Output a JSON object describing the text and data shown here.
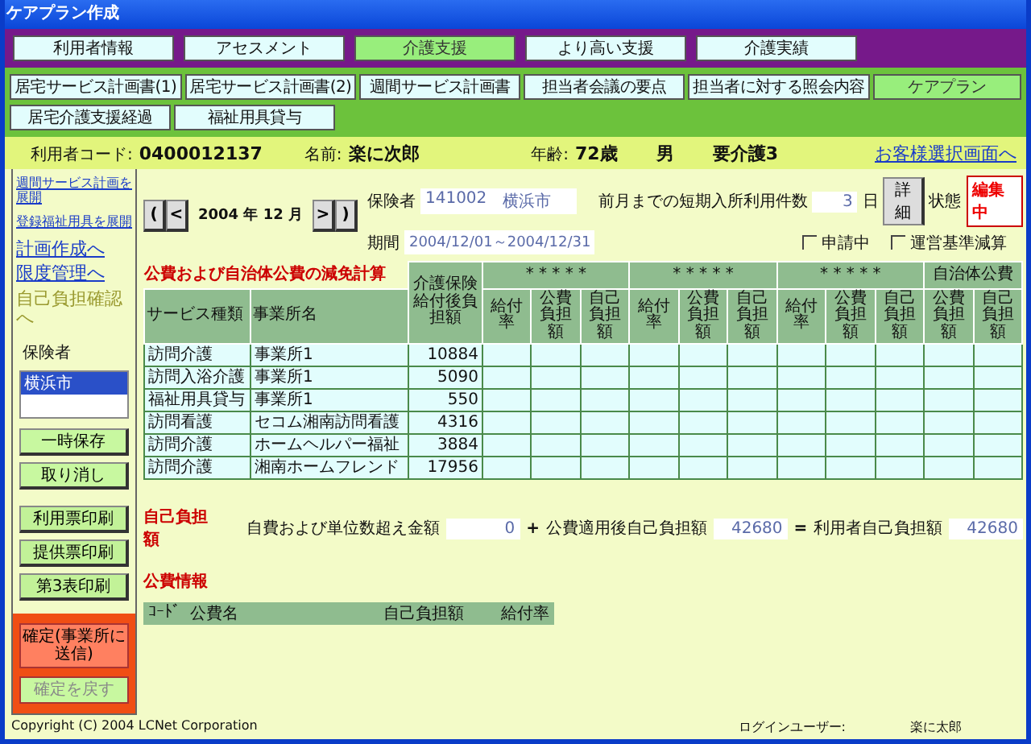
{
  "window": {
    "title": "ケアプラン作成"
  },
  "main_tabs": [
    {
      "label": "利用者情報",
      "selected": false
    },
    {
      "label": "アセスメント",
      "selected": false
    },
    {
      "label": "介護支援",
      "selected": true
    },
    {
      "label": "より高い支援",
      "selected": false
    },
    {
      "label": "介護実績",
      "selected": false
    }
  ],
  "sub_tabs": [
    {
      "label": "居宅サービス計画書(1)",
      "selected": false
    },
    {
      "label": "居宅サービス計画書(2)",
      "selected": false
    },
    {
      "label": "週間サービス計画書",
      "selected": false
    },
    {
      "label": "担当者会議の要点",
      "selected": false
    },
    {
      "label": "担当者に対する照会内容",
      "selected": false
    },
    {
      "label": "ケアプラン",
      "selected": true
    },
    {
      "label": "居宅介護支援経過",
      "selected": false
    },
    {
      "label": "福祉用具貸与",
      "selected": false
    }
  ],
  "client": {
    "code_label": "利用者コード:",
    "code": "0400012137",
    "name_label": "名前:",
    "name": "楽に次郎",
    "age_label": "年齢:",
    "age": "72歳",
    "sex": "男",
    "care_level": "要介護3",
    "link": "お客様選択画面へ"
  },
  "sidebar": {
    "links": [
      {
        "label": "週間サービス計画を展開",
        "kind": "small",
        "disabled": false
      },
      {
        "label": "登録福祉用具を展開",
        "kind": "small",
        "disabled": false
      },
      {
        "label": "計画作成へ",
        "kind": "large",
        "disabled": false
      },
      {
        "label": "限度管理へ",
        "kind": "large",
        "disabled": false
      },
      {
        "label": "自己負担確認へ",
        "kind": "large",
        "disabled": true
      }
    ],
    "insurer_label": "保険者",
    "insurer_list": [
      {
        "label": "横浜市",
        "selected": true
      }
    ],
    "buttons": [
      {
        "label": "一時保存",
        "kind": "edit"
      },
      {
        "label": "取り消し",
        "kind": "edit"
      },
      {
        "label": "利用票印刷",
        "kind": "print"
      },
      {
        "label": "提供票印刷",
        "kind": "print"
      },
      {
        "label": "第3表印刷",
        "kind": "print"
      }
    ],
    "confirm_buttons": [
      {
        "label": "確定(事業所に送信)",
        "disabled": false
      },
      {
        "label": "確定を戻す",
        "disabled": true
      }
    ]
  },
  "period_nav": {
    "prev_buttons": [
      "(",
      "<"
    ],
    "month": "2004 年 12 月",
    "next_buttons": [
      ">",
      ")"
    ]
  },
  "insurer": {
    "label": "保険者",
    "code": "141002",
    "name": "横浜市"
  },
  "period": {
    "label": "期間",
    "value": "2004/12/01～2004/12/31"
  },
  "short_stay": {
    "label": "前月までの短期入所利用件数",
    "value": "3",
    "unit": "日",
    "button": "詳細"
  },
  "status": {
    "label": "状態",
    "value": "編集中"
  },
  "checkboxes": [
    {
      "label": "申請中",
      "checked": false
    },
    {
      "label": "運営基準減算",
      "checked": false
    }
  ],
  "reduction_table": {
    "title": "公費および自治体公費の減免計算",
    "columns": [
      "サービス種類",
      "事業所名",
      "介護保険給付後負担額"
    ],
    "groups": [
      {
        "label": "* * * * *",
        "columns": [
          "給付率",
          "公費負担額",
          "自己負担額"
        ]
      },
      {
        "label": "* * * * *",
        "columns": [
          "給付率",
          "公費負担額",
          "自己負担額"
        ]
      },
      {
        "label": "* * * * *",
        "columns": [
          "給付率",
          "公費負担額",
          "自己負担額"
        ]
      },
      {
        "label": "自治体公費",
        "columns": [
          "公費負担額",
          "自己負担額"
        ]
      }
    ],
    "rows": [
      {
        "service": "訪問介護",
        "office": "事業所1",
        "amount": "10884"
      },
      {
        "service": "訪問入浴介護",
        "office": "事業所1",
        "amount": "5090"
      },
      {
        "service": "福祉用具貸与",
        "office": "事業所1",
        "amount": "550"
      },
      {
        "service": "訪問看護",
        "office": "セコム湘南訪問看護",
        "amount": "4316"
      },
      {
        "service": "訪問介護",
        "office": "ホームヘルパー福祉",
        "amount": "3884"
      },
      {
        "service": "訪問介護",
        "office": "湘南ホームフレンド",
        "amount": "17956"
      }
    ]
  },
  "self_pay": {
    "title": "自己負担額",
    "terms": [
      {
        "label": "自費および単位数超え金額",
        "value": "0"
      },
      {
        "label": "公費適用後自己負担額",
        "value": "42680"
      },
      {
        "label": "利用者自己負担額",
        "value": "42680"
      }
    ],
    "operators": [
      "+",
      "="
    ]
  },
  "public_info": {
    "title": "公費情報",
    "columns": [
      "ｺｰﾄﾞ",
      "公費名",
      "自己負担額",
      "給付率"
    ]
  },
  "footer": {
    "copyright": "Copyright (C) 2004 LCNet Corporation",
    "login_label": "ログインユーザー:",
    "login_user": "楽に太郎"
  }
}
